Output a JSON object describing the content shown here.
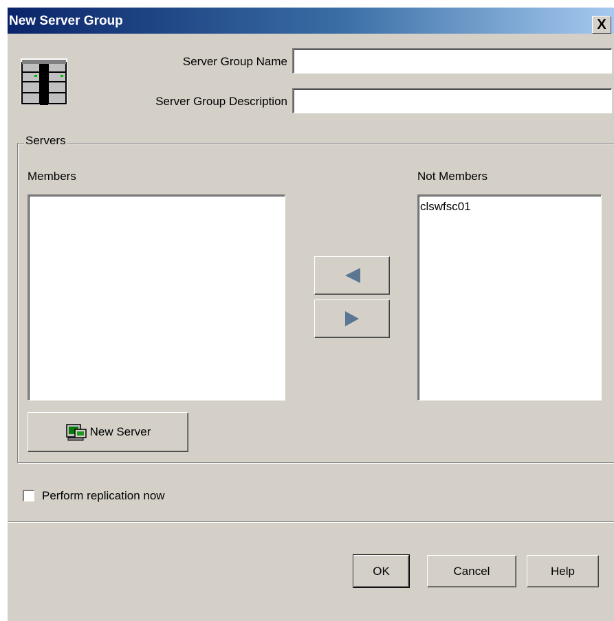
{
  "window": {
    "title": "New Server Group",
    "close_label": "X"
  },
  "form": {
    "name_label": "Server Group Name",
    "name_value": "",
    "description_label": "Server Group Description",
    "description_value": ""
  },
  "servers": {
    "group_label": "Servers",
    "members_label": "Members",
    "members": [],
    "not_members_label": "Not Members",
    "not_members": [
      "clswfsc01"
    ],
    "add_icon": "arrow-left-icon",
    "remove_icon": "arrow-right-icon",
    "new_server_label": "New Server",
    "new_server_icon": "server-icon"
  },
  "replication": {
    "label": "Perform replication now",
    "checked": false
  },
  "buttons": {
    "ok": "OK",
    "cancel": "Cancel",
    "help": "Help"
  }
}
